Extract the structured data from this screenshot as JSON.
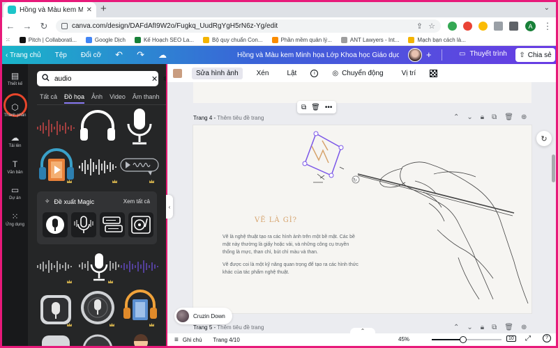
{
  "browser": {
    "tab_title": "Hồng và Màu kem Minh họa Lớ",
    "url": "canva.com/design/DAFdAfI9W2o/Fugkq_UudRgYgH5rN6z-Yg/edit",
    "profile_initial": "A",
    "bookmarks": [
      "Pitch | Collaborati...",
      "Google Dịch",
      "Kế Hoạch SEO La...",
      "Bộ quy chuẩn Con...",
      "Phần mềm quản lý...",
      "ANT Lawyers - Int...",
      "Mạch bạn cách là..."
    ],
    "bookmark_colors": [
      "#111111",
      "#4285f4",
      "#188038",
      "#f4b400",
      "#fb8c00",
      "#9e9e9e",
      "#f4b400"
    ]
  },
  "canva_header": {
    "home": "Trang chủ",
    "file": "Tệp",
    "resize": "Đổi cỡ",
    "doc_title": "Hồng và Màu kem Minh họa Lớp Khoa học Giáo dục Bài thu...",
    "present": "Thuyết trình",
    "share": "Chia sẻ"
  },
  "rail": [
    {
      "label": "Thiết kế",
      "icon": "layout-icon",
      "glyph": "▤"
    },
    {
      "label": "Thành phần",
      "icon": "elements-icon",
      "glyph": "⬡"
    },
    {
      "label": "Tải lên",
      "icon": "upload-icon",
      "glyph": "☁"
    },
    {
      "label": "Văn bản",
      "icon": "text-icon",
      "glyph": "T"
    },
    {
      "label": "Dự án",
      "icon": "folder-icon",
      "glyph": "▭"
    },
    {
      "label": "Ứng dụng",
      "icon": "apps-icon",
      "glyph": "⁙"
    }
  ],
  "panel": {
    "search_value": "audio",
    "tabs": [
      "Tất cả",
      "Đồ họa",
      "Ảnh",
      "Video",
      "Âm thanh"
    ],
    "active_tab": "Đồ họa",
    "magic_title": "Đề xuất Magic",
    "magic_see_all": "Xem tất cả"
  },
  "toolbar": {
    "edit_image": "Sửa hình ảnh",
    "crop": "Xén",
    "flip": "Lật",
    "animate": "Chuyển động",
    "position": "Vị trí",
    "swatch_color": "#c99d80"
  },
  "canvas": {
    "page4_label": "Trang 4",
    "page4_sub": "Thêm tiêu đề trang",
    "heading": "VẼ LÀ GÌ?",
    "para1": "Vẽ là nghệ thuật tạo ra các hình ảnh trên một bề mặt. Các bề mặt này thường là giấy hoặc vải, và những công cụ truyền thống là mực, than chì, bút chì màu và than.",
    "para2": "Vẽ được coi là một kỹ năng quan trọng để tạo ra các hình thức khác của tác phẩm nghệ thuật.",
    "page5_label": "Trang 5",
    "page5_sub": "Thêm tiêu đề trang",
    "music": "Cruzin Down"
  },
  "footer": {
    "notes": "Ghi chú",
    "page": "Trang 4/10",
    "zoom": "45%",
    "zoom_level": 0.45,
    "page_count": "10"
  }
}
